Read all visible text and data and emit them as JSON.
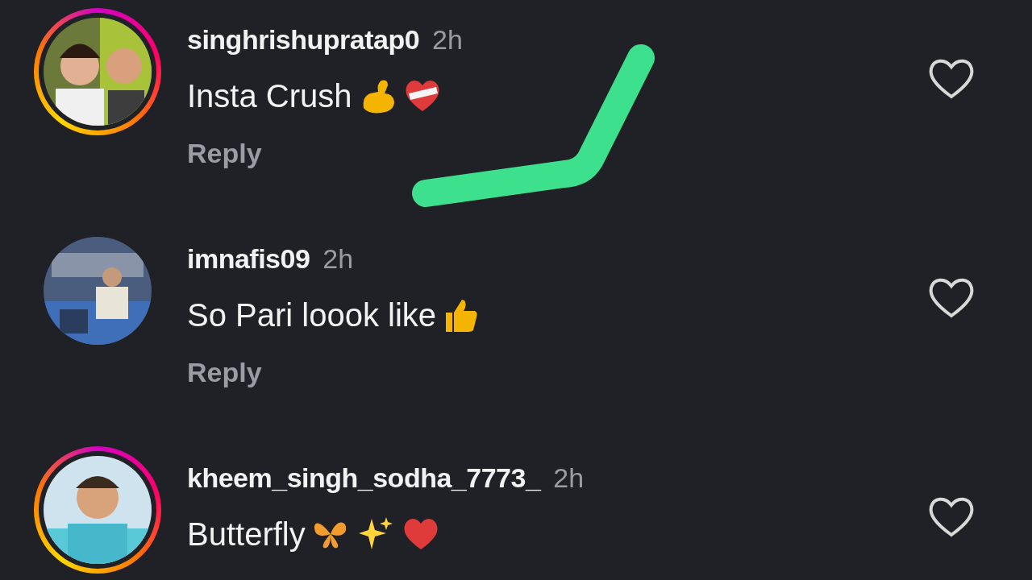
{
  "comments": [
    {
      "username": "singhrishupratap0",
      "time": "2h",
      "text": "Insta Crush",
      "emojis": [
        {
          "kind": "muscle"
        },
        {
          "kind": "mended-heart"
        }
      ],
      "reply": "Reply",
      "story_ring": true,
      "liked": false
    },
    {
      "username": "imnafis09",
      "time": "2h",
      "text": "So Pari loook like",
      "emojis": [
        {
          "kind": "thumbs-up"
        }
      ],
      "reply": "Reply",
      "story_ring": false,
      "liked": false
    },
    {
      "username": "kheem_singh_sodha_7773_",
      "time": "2h",
      "text": "Butterfly",
      "emojis": [
        {
          "kind": "butterfly"
        },
        {
          "kind": "sparkles"
        },
        {
          "kind": "heart"
        }
      ],
      "story_ring": true,
      "liked": false
    }
  ],
  "annotation": {
    "kind": "highlighter"
  }
}
